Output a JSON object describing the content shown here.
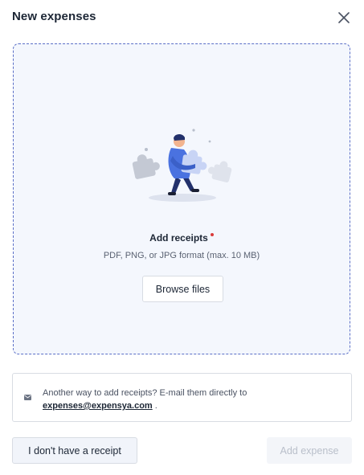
{
  "modal": {
    "title": "New expenses",
    "close_icon": "close-icon"
  },
  "dropzone": {
    "illustration": "person-carrying-puzzle-piece-illustration",
    "title": "Add receipts",
    "subtitle": "PDF, PNG, or JPG format (max. 10 MB)",
    "browse_label": "Browse files"
  },
  "info": {
    "icon": "mail-icon",
    "text": "Another way to add receipts? E-mail them directly to",
    "email": "expenses@expensya.com",
    "suffix": " ."
  },
  "footer": {
    "no_receipt_label": "I don't have a receipt",
    "add_expense_label": "Add expense"
  },
  "colors": {
    "accent": "#5b6fc7",
    "required": "#d93b3b",
    "dropzone_bg": "#f4f7fd",
    "disabled_text": "#b9bfca"
  }
}
